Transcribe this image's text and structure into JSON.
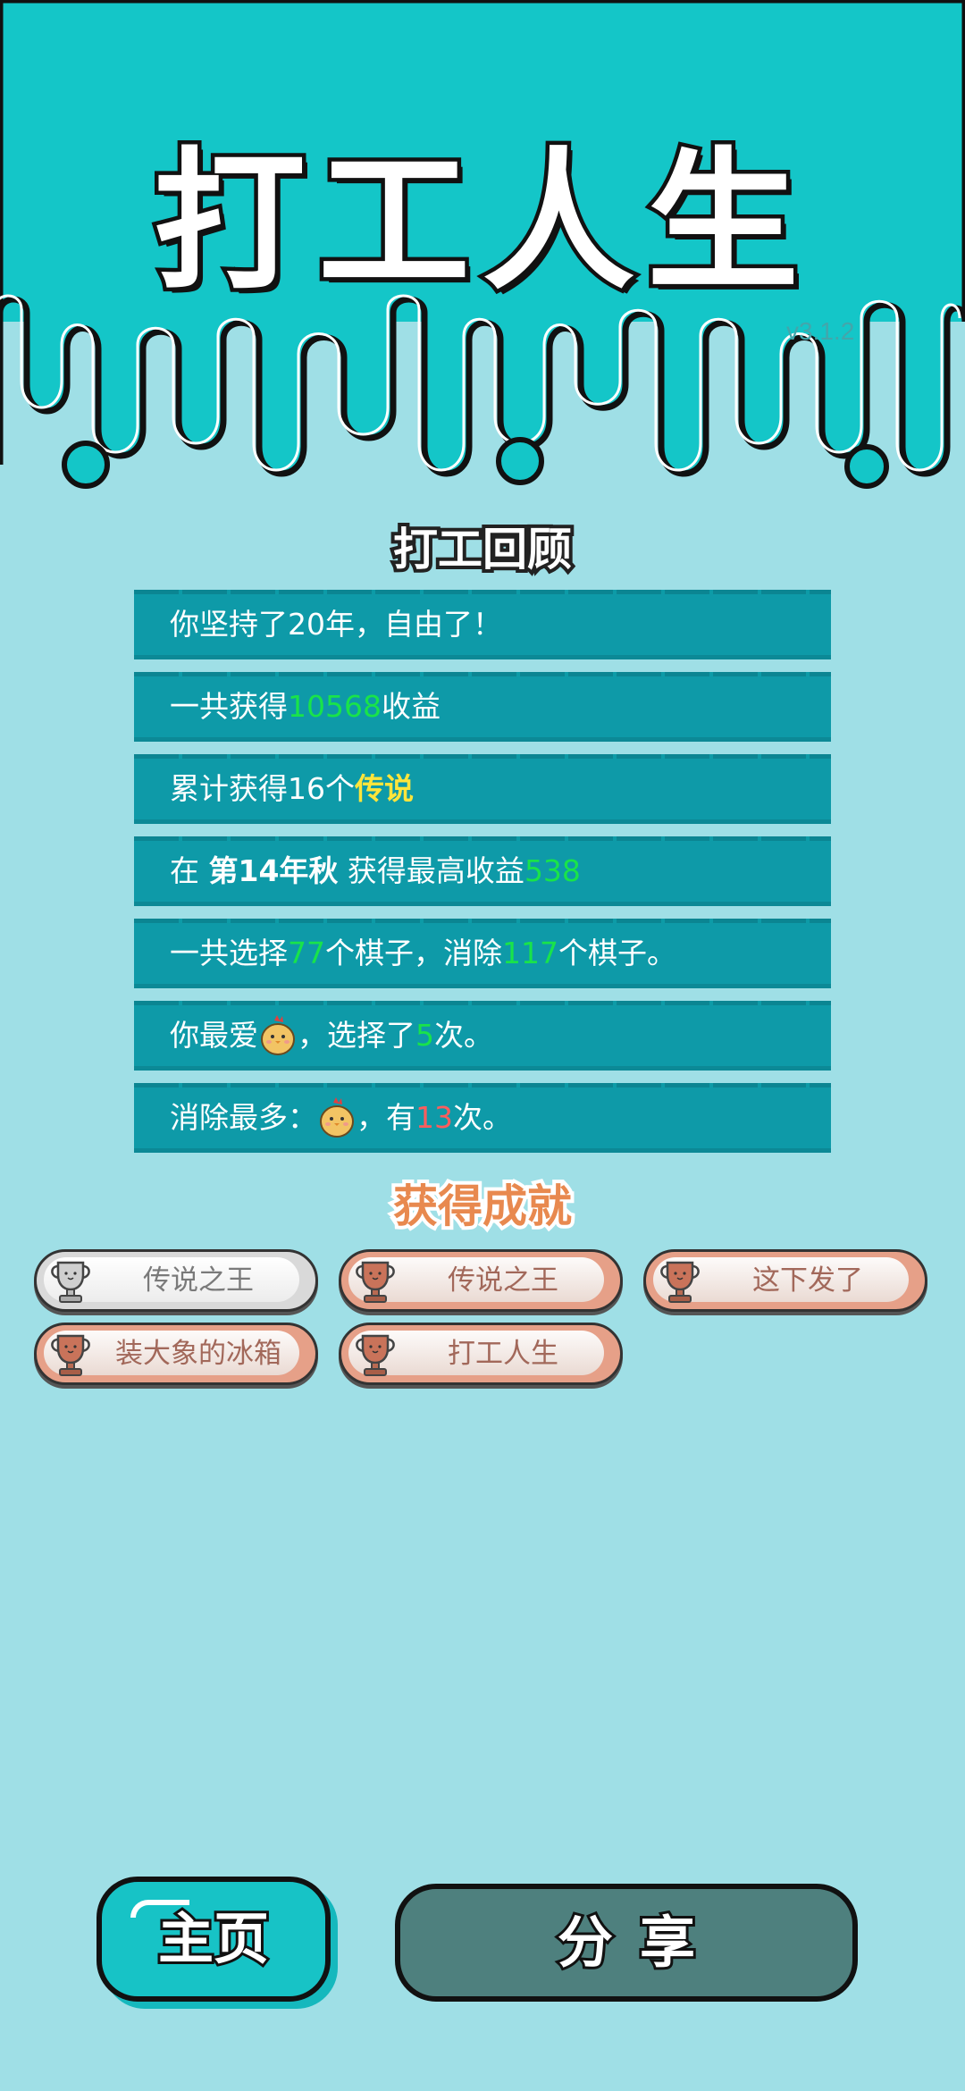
{
  "colors": {
    "header_bg": "#14c6c8",
    "page_bg": "#9fdfe6",
    "row_bg": "#0e9aa8",
    "highlight_green": "#19e34a",
    "highlight_yellow": "#ffe53b",
    "highlight_red": "#ff5d5d",
    "share_button": "#4e807e",
    "home_button": "#17c3c6"
  },
  "header": {
    "title": "打工人生",
    "version": "v3.1.2"
  },
  "review": {
    "title": "打工回顾",
    "rows": [
      {
        "parts": [
          "你坚持了20年，自由了！"
        ]
      },
      {
        "parts": [
          "一共获得",
          "10568",
          "收益"
        ]
      },
      {
        "parts": [
          "累计获得16个",
          "传说"
        ]
      },
      {
        "parts": [
          "在 ",
          "第14年秋",
          " 获得最高收益",
          "538"
        ]
      },
      {
        "parts": [
          "一共选择",
          "77",
          "个棋子，消除",
          "117",
          "个棋子。"
        ]
      },
      {
        "parts": [
          "你最爱",
          "，选择了",
          "5",
          "次。"
        ],
        "icon": "chick-icon"
      },
      {
        "parts": [
          "消除最多：",
          "，有",
          "13",
          "次。"
        ],
        "icon": "chick-icon"
      }
    ]
  },
  "achievements": {
    "title": "获得成就",
    "items": [
      {
        "label": "传说之王",
        "tier": "silver",
        "icon": "trophy-icon"
      },
      {
        "label": "传说之王",
        "tier": "bronze",
        "icon": "trophy-icon"
      },
      {
        "label": "这下发了",
        "tier": "bronze",
        "icon": "trophy-icon"
      },
      {
        "label": "装大象的冰箱",
        "tier": "bronze",
        "icon": "trophy-icon"
      },
      {
        "label": "打工人生",
        "tier": "bronze",
        "icon": "trophy-icon"
      }
    ]
  },
  "buttons": {
    "home": "主页",
    "share": "分享"
  }
}
